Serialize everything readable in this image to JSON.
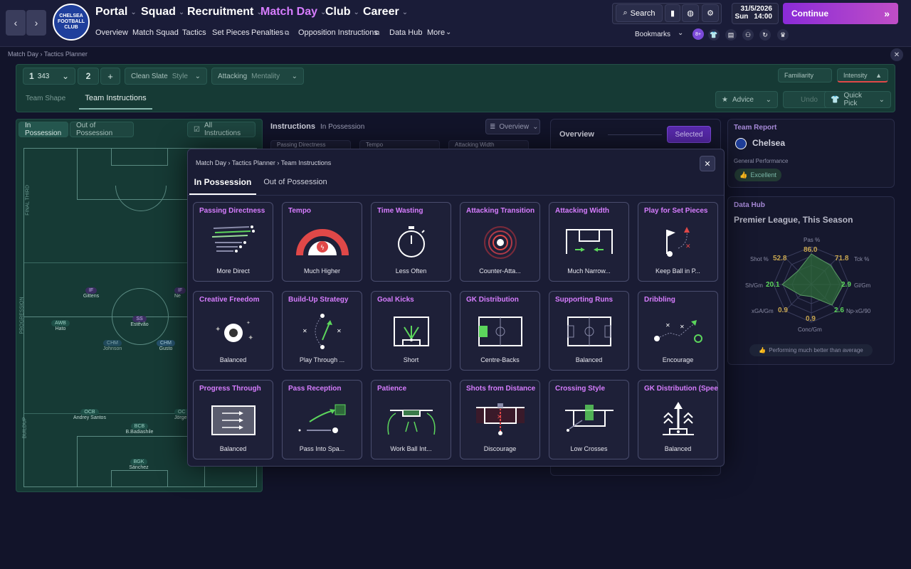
{
  "topbar": {
    "menus": [
      "Portal",
      "Squad",
      "Recruitment",
      "Match Day",
      "Club",
      "Career"
    ],
    "sublinks": [
      "Overview",
      "Match Squad",
      "Tactics",
      "Set Pieces",
      "Penalties",
      "Opposition Instructions",
      "Data Hub",
      "More"
    ],
    "search_label": "Search",
    "date": "31/5/2026",
    "day": "Sun",
    "time": "14:00",
    "continue_label": "Continue",
    "bookmarks_label": "Bookmarks",
    "crest_text": "CHELSEA FOOTBALL CLUB",
    "notif_count": "8+"
  },
  "breadcrumb": {
    "items": [
      "Match Day",
      "Tactics Planner"
    ]
  },
  "tactics_bar": {
    "slot": "1",
    "formation": "343",
    "slot2": "2",
    "add": "+",
    "style_name": "Clean Slate",
    "style_label": "Style",
    "mentality_name": "Attacking",
    "mentality_label": "Mentality",
    "familiarity_label": "Familiarity",
    "intensity_label": "Intensity",
    "tabs": [
      "Team Shape",
      "Team Instructions"
    ],
    "advice_label": "Advice",
    "undo_label": "Undo",
    "quickpick_label": "Quick Pick"
  },
  "pitch": {
    "tabs": [
      "In Possession",
      "Out of Possession"
    ],
    "all_instructions": "All Instructions",
    "zones": [
      "FINAL THIRD",
      "PROGRESSION",
      "BUILDUP"
    ],
    "players": [
      {
        "role": "IF",
        "name": "Gittens"
      },
      {
        "role": "IF",
        "name": "Ne"
      },
      {
        "role": "SS",
        "name": "Estêvão"
      },
      {
        "role": "AWB",
        "name": "Hato"
      },
      {
        "role": "CHM",
        "name": "Johnson"
      },
      {
        "role": "CHM",
        "name": "Gusto"
      },
      {
        "role": "OCB",
        "name": "Andrey Santos"
      },
      {
        "role": "BCB",
        "name": "B.Badiashile"
      },
      {
        "role": "OC",
        "name": "Jörge"
      },
      {
        "role": "BGK",
        "name": "Sánchez"
      }
    ]
  },
  "instructions_header": {
    "title": "Instructions",
    "subtitle": "In Possession",
    "overview_select": "Overview",
    "partial_chips": [
      "Passing Directness",
      "Tempo",
      "Attacking Width"
    ]
  },
  "overview_panel": {
    "title": "Overview",
    "selected_label": "Selected"
  },
  "team_report": {
    "title": "Team Report",
    "team": "Chelsea",
    "perf_label": "General Performance",
    "perf_value": "Excellent"
  },
  "data_hub": {
    "title": "Data Hub",
    "subtitle": "Premier League, This Season",
    "stats": [
      {
        "label": "Pas %",
        "value": "86.0"
      },
      {
        "label": "Tck %",
        "value": "71.8"
      },
      {
        "label": "Gl/Gm",
        "value": "2.9"
      },
      {
        "label": "Np-xG/90",
        "value": "2.6"
      },
      {
        "label": "Conc/Gm",
        "value": "0.9"
      },
      {
        "label": "xGA/Gm",
        "value": "0.9"
      },
      {
        "label": "Sh/Gm",
        "value": "20.1"
      },
      {
        "label": "Shot %",
        "value": "52.8"
      }
    ],
    "footer": "Performing much better than average"
  },
  "modal": {
    "breadcrumb": [
      "Match Day",
      "Tactics Planner",
      "Team Instructions"
    ],
    "tabs": [
      "In Possession",
      "Out of Possession"
    ],
    "cards": [
      {
        "title": "Passing Directness",
        "value": "More Direct"
      },
      {
        "title": "Tempo",
        "value": "Much Higher"
      },
      {
        "title": "Time Wasting",
        "value": "Less Often"
      },
      {
        "title": "Attacking Transition",
        "value": "Counter-Atta..."
      },
      {
        "title": "Attacking Width",
        "value": "Much Narrow..."
      },
      {
        "title": "Play for Set Pieces",
        "value": "Keep Ball in P..."
      },
      {
        "title": "Creative Freedom",
        "value": "Balanced"
      },
      {
        "title": "Build-Up Strategy",
        "value": "Play Through ..."
      },
      {
        "title": "Goal Kicks",
        "value": "Short"
      },
      {
        "title": "GK Distribution",
        "value": "Centre-Backs"
      },
      {
        "title": "Supporting Runs",
        "value": "Balanced"
      },
      {
        "title": "Dribbling",
        "value": "Encourage"
      },
      {
        "title": "Progress Through",
        "value": "Balanced"
      },
      {
        "title": "Pass Reception",
        "value": "Pass Into Spa..."
      },
      {
        "title": "Patience",
        "value": "Work Ball Int..."
      },
      {
        "title": "Shots from Distance",
        "value": "Discourage"
      },
      {
        "title": "Crossing Style",
        "value": "Low Crosses"
      },
      {
        "title": "GK Distribution (Speed",
        "value": "Balanced"
      }
    ]
  },
  "colors": {
    "accent": "#d77dff",
    "pitch": "#163a35",
    "continue_start": "#8a2bd8",
    "continue_end": "#c04ec6",
    "highlight_green": "#5cd65c",
    "highlight_red": "#e04848"
  }
}
